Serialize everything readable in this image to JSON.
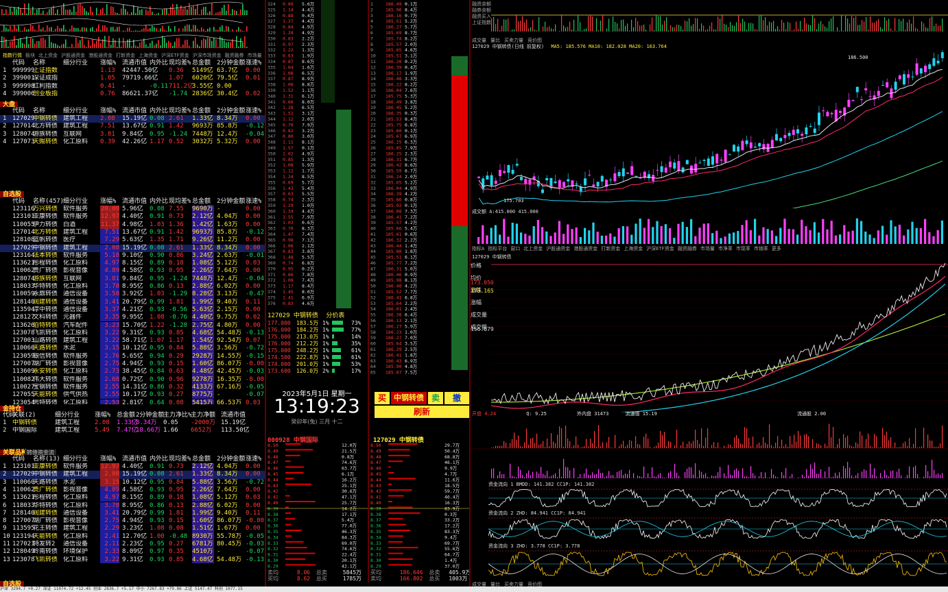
{
  "toolbar_tabs": [
    "指数行情",
    "板块",
    "北上资金",
    "沪股通资金",
    "港股通资金",
    "打新资金",
    "上海资金",
    "沪深ETF资金",
    "沪深市场资金",
    "融资融券",
    "市场量"
  ],
  "index_table": {
    "columns": [
      "代码",
      "名称",
      "细分行业",
      "涨幅%",
      "流通市值",
      "内外比",
      "现均差%",
      "总金额",
      "2分钟金额",
      "涨速%"
    ],
    "rows": [
      {
        "n": "1",
        "code": "999999",
        "name": "上证指数",
        "chg": "1.13",
        "mv": "42447.50亿",
        "io": "-",
        "diff": "0.36",
        "amt": "5149亿",
        "m2": "63.7亿",
        "spd": "0.00"
      },
      {
        "n": "2",
        "code": "399001",
        "name": "深证成指",
        "chg": "1.05",
        "mv": "79719.66亿",
        "io": "-",
        "diff": "1.07",
        "amt": "6020亿",
        "m2": "79.5亿",
        "spd": "0.01"
      },
      {
        "n": "3",
        "code": "999998",
        "name": "红利指数",
        "chg": "0.41",
        "mv": "-",
        "io": "-0.11",
        "diff": "711.2亿",
        "amt": "3.55亿",
        "m2": "0.00",
        "spd": ""
      },
      {
        "n": "4",
        "code": "399006",
        "name": "创业板指",
        "chg": "0.76",
        "mv": "86621.37亿",
        "io": "-",
        "diff": "-1.74",
        "amt": "2836亿",
        "m2": "30.4亿",
        "spd": "0.02"
      }
    ]
  },
  "big_section": {
    "title": "大盘",
    "columns": [
      "代码",
      "名称",
      "细分行业",
      "涨幅%",
      "流通市值",
      "内外比",
      "现均差%",
      "总金额",
      "2分钟金额",
      "涨速%"
    ],
    "rows": [
      {
        "n": "1",
        "code": "127029",
        "name": "中钢转债",
        "ind": "建筑工程",
        "chg": "2.08",
        "mv": "15.19亿",
        "io": "0.08",
        "diff": "2.61",
        "amt": "1.33亿",
        "m2": "8.34万",
        "spd": "0.00"
      },
      {
        "n": "2",
        "code": "127014",
        "name": "北方转债",
        "ind": "建筑工程",
        "chg": "7.51",
        "mv": "13.67亿",
        "io": "0.91",
        "diff": "1.42",
        "amt": "9693万",
        "m2": "85.8万",
        "spd": "-0.12"
      },
      {
        "n": "3",
        "code": "128074",
        "name": "游族转债",
        "ind": "互联网",
        "chg": "3.81",
        "mv": "9.84亿",
        "io": "0.95",
        "diff": "-1.24",
        "amt": "7448万",
        "m2": "12.4万",
        "spd": "-0.04"
      },
      {
        "n": "4",
        "code": "127073",
        "name": "天赐转债",
        "ind": "化工原料",
        "chg": "0.39",
        "mv": "42.26亿",
        "io": "1.17",
        "diff": "0.52",
        "amt": "3032万",
        "m2": "5.32万",
        "spd": "0.00"
      }
    ]
  },
  "self_section": {
    "title": "自选股",
    "columns": [
      "代码",
      "名称(457)",
      "细分行业",
      "涨幅%",
      "流通市值",
      "内外比",
      "现均差%",
      "总金额",
      "2分钟金额",
      "涨速%"
    ],
    "rows": [
      {
        "code": "123116",
        "name": "万兴转债",
        "ind": "软件服务",
        "chg": "20.00",
        "mv": "5.96亿",
        "io": "0.08",
        "diff": "7.55",
        "amt": "9690万",
        "m2": "-",
        "spd": "0.00"
      },
      {
        "code": "123101",
        "name": "亚康转债",
        "ind": "软件服务",
        "chg": "12.97",
        "mv": "4.40亿",
        "io": "0.91",
        "diff": "0.73",
        "amt": "2.12亿",
        "m2": "4.04万",
        "spd": "0.00"
      },
      {
        "code": "110055",
        "name": "伊力转债",
        "ind": "白酒",
        "chg": "11.37",
        "mv": "4.98亿",
        "io": "1.03",
        "diff": "1.36",
        "amt": "1.42亿",
        "m2": "1.63万",
        "spd": "0.00"
      },
      {
        "code": "127014",
        "name": "北方转债",
        "ind": "建筑工程",
        "chg": "7.51",
        "mv": "13.67亿",
        "io": "0.91",
        "diff": "1.42",
        "amt": "9693万",
        "m2": "85.8万",
        "spd": "-0.12"
      },
      {
        "code": "128108",
        "name": "蓝帆转债",
        "ind": "医疗",
        "chg": "7.29",
        "mv": "5.63亿",
        "io": "1.35",
        "diff": "1.71",
        "amt": "9.26亿",
        "m2": "11.2万",
        "spd": "0.00"
      },
      {
        "code": "127029",
        "name": "中钢转债",
        "ind": "建筑工程",
        "chg": "2.08",
        "mv": "15.19亿",
        "io": "0.08",
        "diff": "2.61",
        "amt": "1.33亿",
        "m2": "8.34万",
        "spd": "0.00"
      },
      {
        "code": "123164",
        "name": "法本转债",
        "ind": "软件服务",
        "chg": "5.18",
        "mv": "9.10亿",
        "io": "0.90",
        "diff": "0.86",
        "amt": "3.24亿",
        "m2": "2.63万",
        "spd": "-0.01"
      },
      {
        "code": "113621",
        "name": "彤程转债",
        "ind": "化工原料",
        "chg": "4.97",
        "mv": "8.15亿",
        "io": "0.89",
        "diff": "0.18",
        "amt": "1.08亿",
        "m2": "5.12万",
        "spd": "0.03"
      },
      {
        "code": "110062",
        "name": "贵广转债",
        "ind": "影视音像",
        "chg": "4.89",
        "mv": "4.58亿",
        "io": "0.93",
        "diff": "0.95",
        "amt": "2.26亿",
        "m2": "7.64万",
        "spd": "0.00"
      },
      {
        "code": "128074",
        "name": "游族转债",
        "ind": "互联网",
        "chg": "3.81",
        "mv": "9.84亿",
        "io": "0.95",
        "diff": "-1.24",
        "amt": "7448万",
        "m2": "12.4万",
        "spd": "-0.04"
      },
      {
        "code": "118033",
        "name": "华特转债",
        "ind": "化工原料",
        "chg": "3.78",
        "mv": "8.95亿",
        "io": "0.86",
        "diff": "0.13",
        "amt": "2.88亿",
        "m2": "6.02万",
        "spd": "0.00"
      },
      {
        "code": "110059",
        "name": "永鼎转债",
        "ind": "通信设备",
        "chg": "3.58",
        "mv": "3.92亿",
        "io": "1.03",
        "diff": "-1.29",
        "amt": "8.28亿",
        "m2": "3.13万",
        "spd": "-0.47"
      },
      {
        "code": "128140",
        "name": "润建转债",
        "ind": "通信设备",
        "chg": "3.41",
        "mv": "20.79亿",
        "io": "0.99",
        "diff": "1.81",
        "amt": "1.99亿",
        "m2": "9.40万",
        "spd": "0.11"
      },
      {
        "code": "113594",
        "name": "淳中转债",
        "ind": "通信设备",
        "chg": "3.37",
        "mv": "4.21亿",
        "io": "0.93",
        "diff": "-0.56",
        "amt": "5.63亿",
        "m2": "2.15万",
        "spd": "0.00"
      },
      {
        "code": "128127",
        "name": "文科转债",
        "ind": "元器件",
        "chg": "3.35",
        "mv": "9.95亿",
        "io": "1.08",
        "diff": "-0.76",
        "amt": "4.40亿",
        "m2": "9.75万",
        "spd": "0.02"
      },
      {
        "code": "113626",
        "name": "伯特转债",
        "ind": "汽车配件",
        "chg": "3.23",
        "mv": "15.70亿",
        "io": "1.22",
        "diff": "-1.28",
        "amt": "2.75亿",
        "m2": "4.80万",
        "spd": "0.00"
      },
      {
        "code": "123078",
        "name": "飞凯转债",
        "ind": "化工原料",
        "chg": "3.22",
        "mv": "9.31亿",
        "io": "0.93",
        "diff": "0.85",
        "amt": "4.68亿",
        "m2": "54.48万",
        "spd": "-0.13"
      },
      {
        "code": "127003",
        "name": "山路转债",
        "ind": "建筑工程",
        "chg": "3.22",
        "mv": "58.71亿",
        "io": "1.07",
        "diff": "1.17",
        "amt": "1.54亿",
        "m2": "92.54万",
        "spd": "0.07"
      },
      {
        "code": "110060",
        "name": "天路转债",
        "ind": "水泥",
        "chg": "3.15",
        "mv": "10.12亿",
        "io": "0.95",
        "diff": "0.84",
        "amt": "5.88亿",
        "m2": "3.56万",
        "spd": "-0.72"
      },
      {
        "code": "123059",
        "name": "银信转债",
        "ind": "软件服务",
        "chg": "2.76",
        "mv": "5.65亿",
        "io": "0.94",
        "diff": "0.29",
        "amt": "2928万",
        "m2": "14.55万",
        "spd": "-0.15"
      },
      {
        "code": "127007",
        "name": "湖广转债",
        "ind": "影视音像",
        "chg": "2.75",
        "mv": "4.94亿",
        "io": "0.93",
        "diff": "0.15",
        "amt": "1.60亿",
        "m2": "86.07万",
        "spd": "-0.00"
      },
      {
        "code": "113609",
        "name": "永安转债",
        "ind": "化工原料",
        "chg": "2.73",
        "mv": "38.45亿",
        "io": "0.84",
        "diff": "0.63",
        "amt": "4.48亿",
        "m2": "42.45万",
        "spd": "-0.03"
      },
      {
        "code": "110082",
        "name": "伟大转债",
        "ind": "软件服务",
        "chg": "2.68",
        "mv": "0.72亿",
        "io": "0.90",
        "diff": "0.96",
        "amt": "9278万",
        "m2": "16.35万",
        "spd": "-0.00"
      },
      {
        "code": "110027",
        "name": "宝钢转债",
        "ind": "软件服务",
        "chg": "2.55",
        "mv": "14.31亿",
        "io": "0.86",
        "diff": "0.32",
        "amt": "4133万",
        "m2": "67.16万",
        "spd": "-0.05"
      },
      {
        "code": "127055",
        "name": "天能转债",
        "ind": "供气供热",
        "chg": "2.55",
        "mv": "10.17亿",
        "io": "0.93",
        "diff": "0.27",
        "amt": "8775万",
        "m2": "-",
        "spd": "-0.07"
      },
      {
        "code": "123054",
        "name": "思特转债",
        "ind": "化工原料",
        "chg": "2.53",
        "mv": "2.81亿",
        "io": "0.64",
        "diff": "0.08",
        "amt": "5415万",
        "m2": "66.53万",
        "spd": "0.03"
      }
    ]
  },
  "hold_section": {
    "title": "金持仓",
    "columns": [
      "代码",
      "关联(2)",
      "细分行业",
      "涨幅%",
      "总金额",
      "2分钟金额",
      "主力净比%",
      "主力净额",
      "流通市值"
    ],
    "rows": [
      {
        "n": "1",
        "code": "中钢转债",
        "ind": "建筑工程",
        "chg": "2.08",
        "amt": "1.33亿",
        "m2": "8.34万",
        "r": "0.05",
        "net": "-2000万",
        "mv": "15.19亿"
      },
      {
        "n": "2",
        "code": "中钢国际",
        "ind": "建筑工程",
        "chg": "5.49",
        "amt": "7.47亿",
        "m2": "18.66万",
        "r": "1.66",
        "net": "6652万",
        "mv": "113.50亿"
      }
    ]
  },
  "watch_section": {
    "title": "关联品种",
    "tab": "转债资金流",
    "columns": [
      "代码",
      "名称(13)",
      "细分行业",
      "涨幅%",
      "流通市值",
      "内外比",
      "现均差%",
      "总金额",
      "2分钟金额",
      "涨速%"
    ],
    "rows": [
      {
        "n": "1",
        "code": "123101",
        "name": "亚康转债",
        "ind": "软件服务",
        "chg": "12.97",
        "mv": "4.40亿",
        "io": "0.91",
        "diff": "0.73",
        "amt": "2.12亿",
        "m2": "4.04万",
        "spd": "0.00"
      },
      {
        "n": "2",
        "code": "127029",
        "name": "中钢转债",
        "ind": "建筑工程",
        "chg": "2.08",
        "mv": "15.19亿",
        "io": "0.08",
        "diff": "2.61",
        "amt": "1.33亿",
        "m2": "8.34万",
        "spd": "0.00"
      },
      {
        "n": "3",
        "code": "110060",
        "name": "天路转债",
        "ind": "水泥",
        "chg": "3.15",
        "mv": "10.12亿",
        "io": "0.95",
        "diff": "0.84",
        "amt": "5.88亿",
        "m2": "3.56万",
        "spd": "-0.72"
      },
      {
        "n": "4",
        "code": "110062",
        "name": "贵广转债",
        "ind": "影视音像",
        "chg": "4.89",
        "mv": "4.58亿",
        "io": "0.93",
        "diff": "0.95",
        "amt": "2.26亿",
        "m2": "7.64万",
        "spd": "0.00"
      },
      {
        "n": "5",
        "code": "113621",
        "name": "彤程转债",
        "ind": "化工原料",
        "chg": "4.97",
        "mv": "8.15亿",
        "io": "0.89",
        "diff": "0.18",
        "amt": "1.08亿",
        "m2": "5.12万",
        "spd": "0.03"
      },
      {
        "n": "6",
        "code": "118033",
        "name": "华特转债",
        "ind": "化工原料",
        "chg": "3.78",
        "mv": "8.95亿",
        "io": "0.86",
        "diff": "0.13",
        "amt": "2.88亿",
        "m2": "6.02万",
        "spd": "0.00"
      },
      {
        "n": "7",
        "code": "128140",
        "name": "润建转债",
        "ind": "通信设备",
        "chg": "3.41",
        "mv": "20.79亿",
        "io": "0.99",
        "diff": "1.81",
        "amt": "1.99亿",
        "m2": "9.40万",
        "spd": "0.11"
      },
      {
        "n": "8",
        "code": "127007",
        "name": "湖广转债",
        "ind": "影视音像",
        "chg": "2.75",
        "mv": "4.94亿",
        "io": "0.93",
        "diff": "0.15",
        "amt": "1.60亿",
        "m2": "86.07万",
        "spd": "-0.00"
      },
      {
        "n": "9",
        "code": "113595",
        "name": "花王转债",
        "ind": "建筑工程",
        "chg": "2.29",
        "mv": "3.23亿",
        "io": "1.08",
        "diff": "0.08",
        "amt": "1.51亿",
        "m2": "1.67万",
        "spd": "0.00"
      },
      {
        "n": "10",
        "code": "123194",
        "name": "天能转债",
        "ind": "化工原料",
        "chg": "2.41",
        "mv": "12.70亿",
        "io": "1.00",
        "diff": "-0.48",
        "amt": "8930万",
        "m2": "55.78万",
        "spd": "-0.05"
      },
      {
        "n": "11",
        "code": "127021",
        "name": "特发转2",
        "ind": "通信设备",
        "chg": "2.11",
        "mv": "2.23亿",
        "io": "0.95",
        "diff": "0.27",
        "amt": "6781万",
        "m2": "80.45万",
        "spd": "-0.03"
      },
      {
        "n": "12",
        "code": "128049",
        "name": "岭南转债",
        "ind": "环境保护",
        "chg": "2.33",
        "mv": "8.09亿",
        "io": "0.97",
        "diff": "0.35",
        "amt": "4510万",
        "m2": "-",
        "spd": "-0.07"
      },
      {
        "n": "13",
        "code": "123078",
        "name": "飞凯转债",
        "ind": "化工原料",
        "chg": "3.22",
        "mv": "9.31亿",
        "io": "0.93",
        "diff": "0.85",
        "amt": "4.68亿",
        "m2": "54.48万",
        "spd": "-0.13"
      }
    ]
  },
  "tick_section": {
    "title": "127029 中钢转债",
    "subtitle": "分价表"
  },
  "price_dist": [
    {
      "p": "177.000",
      "v": "183.5万",
      "pct": "1%",
      "r": "73%"
    },
    {
      "p": "176.000",
      "v": "184.2万",
      "pct": "1%",
      "r": "77%"
    },
    {
      "p": "175.000",
      "v": "213.0万",
      "pct": "1%",
      "r": "14%"
    },
    {
      "p": "176.000",
      "v": "212.2万",
      "pct": "1%",
      "r": "35%"
    },
    {
      "p": "175.000",
      "v": "248.2万",
      "pct": "1%",
      "r": "61%"
    },
    {
      "p": "174.500",
      "v": "222.8万",
      "pct": "1%",
      "r": "61%"
    },
    {
      "p": "174.000",
      "v": "201.0万",
      "pct": "1%",
      "r": "53%"
    },
    {
      "p": "173.600",
      "v": "126.0万",
      "pct": "2%",
      "r": "17%"
    }
  ],
  "clock": {
    "date": "2023年5月1日 星期一",
    "time": "13:19:23",
    "lunar": "癸卯年(兔) 三月 十二"
  },
  "trade_buttons": {
    "buy": "买",
    "name": "中钢转债",
    "sell": "卖",
    "cancel": "撤",
    "refresh": "刷新"
  },
  "quote_left": {
    "title": "000928 中钢国际",
    "buy_label": "买均",
    "sell_label": "卖均",
    "total_label": "总卖",
    "total_label2": "总买",
    "buy_avg": "8.06",
    "sell_avg": "8.62",
    "total_sell": "5845万",
    "total_buy": "1785万"
  },
  "quote_right": {
    "title": "127029 中钢转债",
    "buy_label": "卖均",
    "sell_label": "买均",
    "total_label": "总卖",
    "total_label2": "总买",
    "sell_avg": "186.646",
    "buy_avg": "166.802",
    "total_sell": "405.9万",
    "total_buy": "1003万"
  },
  "chart_top": {
    "labels": [
      "融资余额",
      "融券余额",
      "融资买入",
      "上证指数"
    ],
    "tabs": [
      "成交量",
      "量比",
      "买卖力量",
      "竞价图"
    ]
  },
  "kline": {
    "info": "127029 中钢转债(日线 前复权)",
    "ma_text": "MA5: 185.576  MA10: 182.028  MA20: 163.764",
    "high_label": "186.500",
    "low_label": "175.703",
    "vol_label": "成交额 A:415.000  415.000"
  },
  "kline_tabs": [
    "指标A",
    "指标平台",
    "窗口",
    "北上资金",
    "沪股通资金",
    "港股通资金",
    "打新资金",
    "上海资金",
    "沪深ETF资金",
    "融资融券",
    "市场量",
    "市净率",
    "市现率",
    "市销率",
    "更多"
  ],
  "intraday": {
    "title": "127029 中钢转债",
    "labels": [
      "价格",
      "均价",
      "涨跌",
      "涨幅",
      "成交量",
      "成交额"
    ],
    "last": "173.050",
    "avg": "173.165",
    "ref_price": "156.879",
    "bottom_left": "开盘 4.24",
    "bottom_mid": "Q: 9.25",
    "bottom_vol": "外内盘 31473",
    "bottom_amt": "流通值 15.19",
    "bottom_right": "流通股 2.00"
  },
  "indicators": [
    {
      "name": "资金流向 1",
      "text": "资金流向 1  BMDD: 141.382  CC1P: 141.382"
    },
    {
      "name": "资金流向 2",
      "text": "资金流向 2  ZHD: 84.941  CC1P: 84.941"
    },
    {
      "name": "资金流向 3",
      "text": "资金流向 3  ZHD: 3.778  CC1P: 3.778"
    }
  ],
  "bottom_tabs": [
    "成交量",
    "量比",
    "买卖力量",
    "竞价图"
  ],
  "status_bar": "沪深  3294.7  +0.27  深证  11074.72  +12.45  创业  2836.7  +5.17  中小  7267.83  +79.86  上证  5147.47  科创  1077.15"
}
